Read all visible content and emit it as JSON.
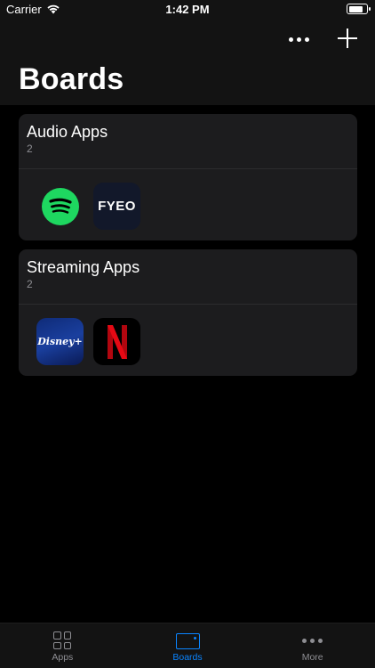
{
  "status_bar": {
    "carrier": "Carrier",
    "time": "1:42 PM"
  },
  "header": {
    "title": "Boards",
    "more_icon": "ellipsis-icon",
    "add_icon": "plus-icon"
  },
  "boards": [
    {
      "name": "Audio Apps",
      "count": "2",
      "apps": [
        {
          "name": "Spotify",
          "icon": "spotify-icon"
        },
        {
          "name": "FYEO",
          "icon": "fyeo-icon",
          "label": "FYEO"
        }
      ]
    },
    {
      "name": "Streaming Apps",
      "count": "2",
      "apps": [
        {
          "name": "Disney+",
          "icon": "disney-plus-icon",
          "label": "Disney+"
        },
        {
          "name": "Netflix",
          "icon": "netflix-icon"
        }
      ]
    }
  ],
  "tab_bar": {
    "tabs": [
      {
        "label": "Apps",
        "icon": "apps-grid-icon",
        "active": false
      },
      {
        "label": "Boards",
        "icon": "boards-icon",
        "active": true
      },
      {
        "label": "More",
        "icon": "more-icon",
        "active": false
      }
    ]
  },
  "colors": {
    "accent": "#0a84ff",
    "card_bg": "#1c1c1e",
    "spotify_green": "#1ed760",
    "netflix_red": "#e50914"
  }
}
